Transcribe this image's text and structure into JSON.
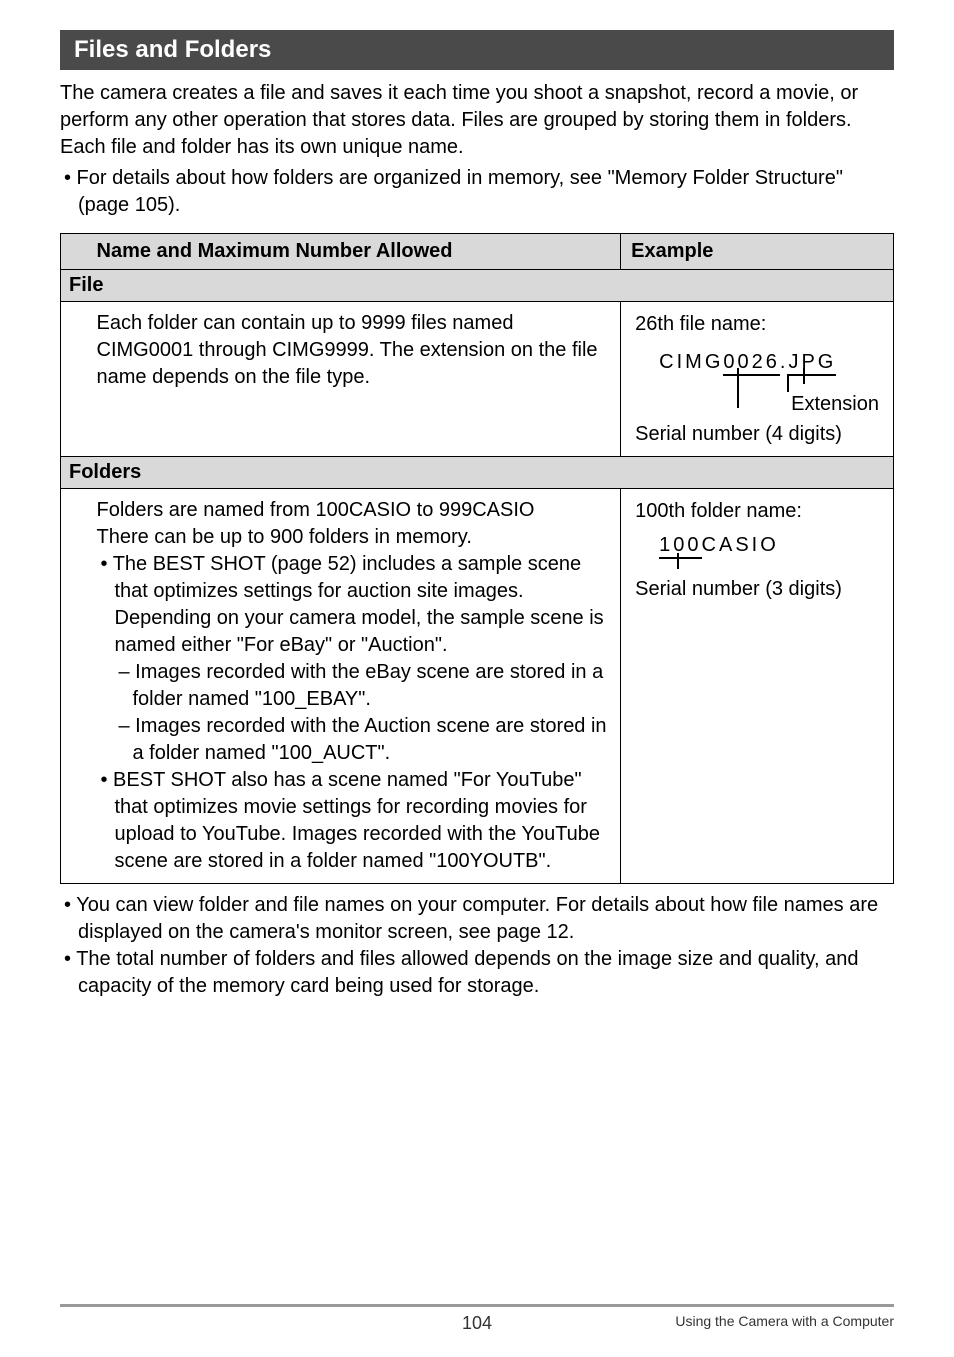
{
  "section_title": "Files and Folders",
  "intro": "The camera creates a file and saves it each time you shoot a snapshot, record a movie, or perform any other operation that stores data. Files are grouped by storing them in folders. Each file and folder has its own unique name.",
  "intro_bullet": "• For details about how folders are organized in memory, see \"Memory Folder Structure\" (page 105).",
  "table": {
    "col1_header": "Name and Maximum Number Allowed",
    "col2_header": "Example",
    "file_label": "File",
    "file_desc": "Each folder can contain up to 9999 files named CIMG0001 through CIMG9999. The extension on the file name depends on the file type.",
    "file_example": {
      "title": "26th file name:",
      "prefix": "CIMG",
      "serial": "0026",
      "dot": ".",
      "ext": "JPG",
      "ext_label": "Extension",
      "serial_label": "Serial number (4 digits)"
    },
    "folders_label": "Folders",
    "folders_desc_1": "Folders are named from 100CASIO to 999CASIO",
    "folders_desc_2": "There can be up to 900 folders in memory.",
    "folders_b1": "• The BEST SHOT (page 52) includes a sample scene that optimizes settings for auction site images. Depending on your camera model, the sample scene is named either \"For eBay\" or \"Auction\".",
    "folders_d1": "– Images recorded with the eBay scene are stored in a folder named \"100_EBAY\".",
    "folders_d2": "– Images recorded with the Auction scene are stored in a folder named \"100_AUCT\".",
    "folders_b2": "• BEST SHOT also has a scene named \"For YouTube\" that optimizes movie settings for recording movies for upload to YouTube. Images recorded with the YouTube scene are stored in a folder named \"100YOUTB\".",
    "folder_example": {
      "title": "100th folder name:",
      "serial": "100",
      "suffix": "CASIO",
      "serial_label": "Serial number (3 digits)"
    }
  },
  "after": {
    "b1": "• You can view folder and file names on your computer. For details about how file names are displayed on the camera's monitor screen, see page 12.",
    "b2": "• The total number of folders and files allowed depends on the image size and quality, and capacity of the memory card being used for storage."
  },
  "footer": {
    "page": "104",
    "right": "Using the Camera with a Computer"
  }
}
